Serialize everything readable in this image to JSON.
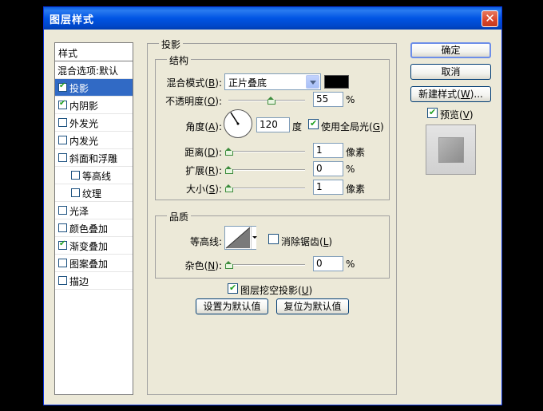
{
  "window": {
    "title": "图层样式",
    "close_glyph": "✕"
  },
  "sidebar": {
    "header": "样式",
    "items": [
      {
        "label": "混合选项:默认",
        "checkbox": false,
        "checked": false,
        "selected": false
      },
      {
        "label": "投影",
        "checkbox": true,
        "checked": true,
        "selected": true
      },
      {
        "label": "内阴影",
        "checkbox": true,
        "checked": true,
        "selected": false
      },
      {
        "label": "外发光",
        "checkbox": true,
        "checked": false,
        "selected": false
      },
      {
        "label": "内发光",
        "checkbox": true,
        "checked": false,
        "selected": false
      },
      {
        "label": "斜面和浮雕",
        "checkbox": true,
        "checked": false,
        "selected": false
      },
      {
        "label": "等高线",
        "checkbox": true,
        "checked": false,
        "selected": false,
        "indent": true
      },
      {
        "label": "纹理",
        "checkbox": true,
        "checked": false,
        "selected": false,
        "indent": true
      },
      {
        "label": "光泽",
        "checkbox": true,
        "checked": false,
        "selected": false
      },
      {
        "label": "颜色叠加",
        "checkbox": true,
        "checked": false,
        "selected": false
      },
      {
        "label": "渐变叠加",
        "checkbox": true,
        "checked": true,
        "selected": false
      },
      {
        "label": "图案叠加",
        "checkbox": true,
        "checked": false,
        "selected": false
      },
      {
        "label": "描边",
        "checkbox": true,
        "checked": false,
        "selected": false
      }
    ]
  },
  "drop_shadow": {
    "group_title": "投影",
    "structure": {
      "title": "结构",
      "blend_mode_label": "混合模式(",
      "blend_mode_key": "B",
      "blend_mode_value": "正片叠底",
      "shadow_color": "#000000",
      "opacity_label": "不透明度(",
      "opacity_key": "O",
      "opacity_value": "55",
      "opacity_unit": "%",
      "opacity_percent": 55,
      "angle_label": "角度(",
      "angle_key": "A",
      "angle_value": "120",
      "angle_unit": "度",
      "global_light_label": "使用全局光(",
      "global_light_key": "G",
      "global_light_checked": true,
      "distance_label": "距离(",
      "distance_key": "D",
      "distance_value": "1",
      "distance_unit": "像素",
      "spread_label": "扩展(",
      "spread_key": "R",
      "spread_value": "0",
      "spread_unit": "%",
      "size_label": "大小(",
      "size_key": "S",
      "size_value": "1",
      "size_unit": "像素",
      "paren_close": "):"
    },
    "quality": {
      "title": "品质",
      "contour_label": "等高线:",
      "anti_alias_label": "消除锯齿(",
      "anti_alias_key": "L",
      "anti_alias_checked": false,
      "noise_label": "杂色(",
      "noise_key": "N",
      "noise_value": "0",
      "noise_unit": "%"
    },
    "knockout_label": "图层挖空投影(",
    "knockout_key": "U",
    "knockout_checked": true,
    "make_default_label": "设置为默认值",
    "reset_default_label": "复位为默认值"
  },
  "buttons": {
    "ok": "确定",
    "cancel": "取消",
    "new_style_label": "新建样式(",
    "new_style_key": "W",
    "new_style_suffix": ")...",
    "preview_label": "预览(",
    "preview_key": "V",
    "preview_checked": true
  }
}
